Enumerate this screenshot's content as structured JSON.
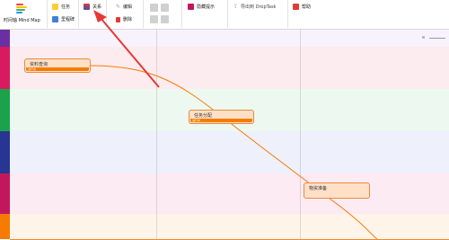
{
  "app": {
    "title": "时间轴 Mind Map"
  },
  "toolbar": {
    "task": "任务",
    "milestone": "里程碑",
    "connect": "关系",
    "edit": "编辑",
    "delete": "删除",
    "hide_hint": "隐藏提示",
    "export": "导出到 DropTask",
    "help": "帮助"
  },
  "nodes": [
    {
      "label": "资料查询",
      "progress_text": "进行中"
    },
    {
      "label": "任务分配",
      "progress_text": "进行中"
    },
    {
      "label": "物资准备",
      "progress_text": ""
    }
  ],
  "lanes": [
    {
      "strip": "#6a2fa0",
      "fill": "#f7f2fb",
      "border": "#7a3aa8"
    },
    {
      "strip": "#d81b60",
      "fill": "#fdecef",
      "border": "#c2185b"
    },
    {
      "strip": "#1aa34a",
      "fill": "#edf8f0",
      "border": "#2e9d4b"
    },
    {
      "strip": "#283593",
      "fill": "#eef0fb",
      "border": "#2d3a9a"
    },
    {
      "strip": "#c2185b",
      "fill": "#fcebf3",
      "border": "#b0176d"
    },
    {
      "strip": "#f57c00",
      "fill": "#fff4ea",
      "border": "#f08a2c"
    }
  ],
  "colors": {
    "accent_red": "#e53935",
    "curve": "#f57c00"
  }
}
